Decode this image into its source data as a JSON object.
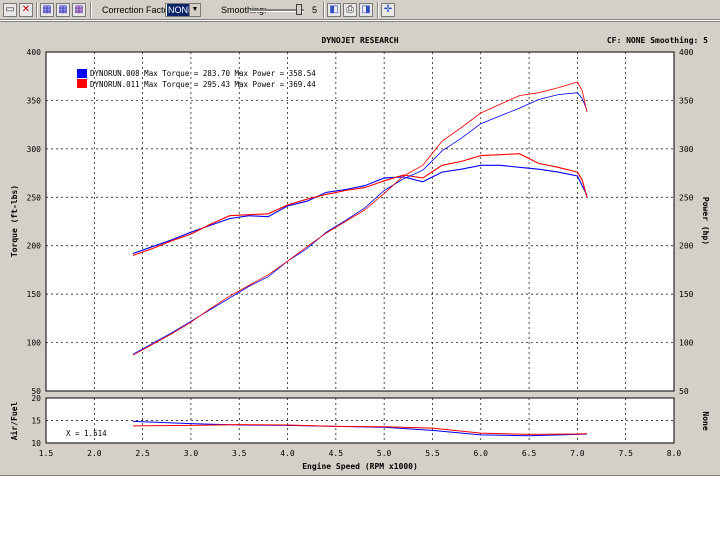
{
  "toolbar": {
    "correction_factor_label": "Correction Factor:",
    "correction_factor_value": "NONE",
    "smoothing_label": "Smoothing:",
    "smoothing_value": "5"
  },
  "chart": {
    "title": "DYNOJET RESEARCH",
    "header_right": "CF: NONE  Smoothing: 5",
    "y_left_label": "Torque (ft-lbs)",
    "y_right_label": "Power (hp)",
    "x_label": "Engine Speed (RPM x1000)",
    "af_left_label": "Air/Fuel",
    "af_right_label": "None",
    "cursor_readout": "X = 1.514",
    "legend": [
      {
        "text": "DYNORUN.008 Max Torque = 283.70 Max Power = 358.54",
        "color": "#0000ff"
      },
      {
        "text": "DYNORUN.011 Max Torque = 295.43 Max Power = 369.44",
        "color": "#ff0000"
      }
    ]
  },
  "chart_data": {
    "type": "line",
    "title": "DYNOJET RESEARCH",
    "xlabel": "Engine Speed (RPM x1000)",
    "ylabel": "Torque (ft-lbs)",
    "y2label": "Power (hp)",
    "xlim": [
      1.5,
      8.0
    ],
    "ylim": [
      50,
      400
    ],
    "x_ticks": [
      "1.5",
      "2.0",
      "2.5",
      "3.0",
      "3.5",
      "4.0",
      "4.5",
      "5.0",
      "5.5",
      "6.0",
      "6.5",
      "7.0",
      "7.5",
      "8.0"
    ],
    "y_ticks": [
      "50",
      "100",
      "150",
      "200",
      "250",
      "300",
      "350",
      "400"
    ],
    "grid": true,
    "series": [
      {
        "name": "DYNORUN.008",
        "measure": "torque",
        "color": "#0000ff",
        "x": [
          2.4,
          2.6,
          2.8,
          3.0,
          3.2,
          3.4,
          3.6,
          3.8,
          4.0,
          4.2,
          4.4,
          4.6,
          4.8,
          5.0,
          5.2,
          5.4,
          5.6,
          5.8,
          6.0,
          6.2,
          6.4,
          6.6,
          6.8,
          7.0,
          7.05,
          7.1
        ],
        "y": [
          192,
          199,
          206,
          214,
          221,
          228,
          231,
          230,
          241,
          246,
          255,
          258,
          262,
          270,
          271,
          266,
          276,
          279,
          283,
          283,
          281,
          279,
          276,
          272,
          262,
          252
        ]
      },
      {
        "name": "DYNORUN.011",
        "measure": "torque",
        "color": "#ff0000",
        "x": [
          2.4,
          2.6,
          2.8,
          3.0,
          3.2,
          3.4,
          3.6,
          3.8,
          4.0,
          4.2,
          4.4,
          4.6,
          4.8,
          5.0,
          5.2,
          5.4,
          5.6,
          5.8,
          6.0,
          6.2,
          6.4,
          6.6,
          6.8,
          7.0,
          7.05,
          7.1
        ],
        "y": [
          190,
          197,
          205,
          212,
          222,
          231,
          232,
          233,
          242,
          248,
          253,
          257,
          260,
          267,
          273,
          270,
          283,
          287,
          293,
          294,
          295,
          285,
          281,
          276,
          268,
          250
        ]
      },
      {
        "name": "DYNORUN.008",
        "measure": "power",
        "color": "#0000ff",
        "x": [
          2.4,
          2.6,
          2.8,
          3.0,
          3.2,
          3.4,
          3.6,
          3.8,
          4.0,
          4.2,
          4.4,
          4.6,
          4.8,
          5.0,
          5.2,
          5.4,
          5.6,
          5.8,
          6.0,
          6.2,
          6.4,
          6.6,
          6.8,
          7.0,
          7.05,
          7.1
        ],
        "y": [
          88,
          99,
          110,
          122,
          134,
          146,
          158,
          168,
          184,
          197,
          214,
          226,
          239,
          257,
          269,
          278,
          298,
          311,
          326,
          334,
          342,
          351,
          356,
          358,
          352,
          340
        ]
      },
      {
        "name": "DYNORUN.011",
        "measure": "power",
        "color": "#ff0000",
        "x": [
          2.4,
          2.6,
          2.8,
          3.0,
          3.2,
          3.4,
          3.6,
          3.8,
          4.0,
          4.2,
          4.4,
          4.6,
          4.8,
          5.0,
          5.2,
          5.4,
          5.6,
          5.8,
          6.0,
          6.2,
          6.4,
          6.6,
          6.8,
          7.0,
          7.05,
          7.1
        ],
        "y": [
          87,
          98,
          109,
          121,
          135,
          148,
          159,
          170,
          184,
          199,
          213,
          225,
          237,
          254,
          272,
          283,
          308,
          322,
          337,
          346,
          355,
          358,
          363,
          369,
          360,
          338
        ]
      }
    ],
    "air_fuel": {
      "ylim": [
        10,
        20
      ],
      "y_ticks": [
        "10",
        "15",
        "20"
      ],
      "series": [
        {
          "name": "DYNORUN.008",
          "color": "#0000ff",
          "x": [
            2.4,
            3.0,
            3.5,
            4.0,
            4.5,
            5.0,
            5.5,
            6.0,
            6.5,
            7.0,
            7.1
          ],
          "y": [
            14.8,
            14.3,
            14.0,
            13.9,
            13.7,
            13.5,
            12.8,
            11.8,
            11.6,
            11.9,
            12.0
          ]
        },
        {
          "name": "DYNORUN.011",
          "color": "#ff0000",
          "x": [
            2.4,
            3.0,
            3.5,
            4.0,
            4.5,
            5.0,
            5.5,
            6.0,
            6.5,
            7.0,
            7.1
          ],
          "y": [
            13.8,
            13.9,
            14.1,
            14.0,
            13.7,
            13.6,
            13.3,
            12.2,
            11.9,
            12.0,
            12.1
          ]
        }
      ]
    }
  }
}
